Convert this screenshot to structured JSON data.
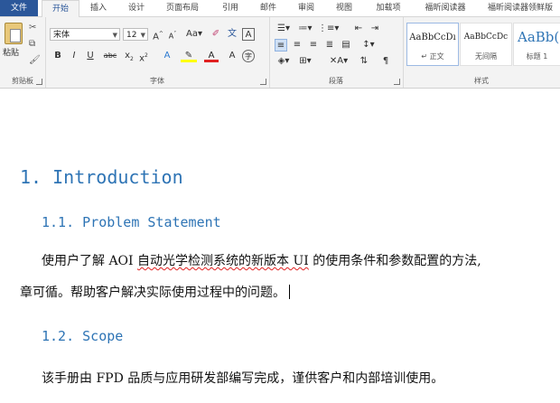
{
  "tabs": [
    "文件",
    "开始",
    "插入",
    "设计",
    "页面布局",
    "引用",
    "邮件",
    "审阅",
    "视图",
    "加载项",
    "福昕阅读器",
    "福昕阅读器领鲜版"
  ],
  "clipboard": {
    "paste_label": "粘贴",
    "group_label": "剪贴板"
  },
  "font": {
    "font_name": "宋体",
    "font_size": "12",
    "group_label": "字体"
  },
  "paragraph": {
    "group_label": "段落"
  },
  "styles": {
    "group_label": "样式",
    "items": [
      {
        "sample": "AaBbCcDı",
        "name": "↵ 正文"
      },
      {
        "sample": "AaBbCcDc",
        "name": "无间隔"
      },
      {
        "sample": "AaBb(",
        "name": "标题 1"
      }
    ]
  },
  "document": {
    "h1": "1.   Introduction",
    "h2_1": "1.1.    Problem Statement",
    "para1_pre": "使用户了解 AOI ",
    "para1_err": "自动光学检测系统的新版本 UI",
    "para1_post": " 的使用条件和参数配置的方法,",
    "para2": "章可循。帮助客户解决实际使用过程中的问题。",
    "h2_2": "1.2.    Scope",
    "para3": "该手册由 FPD 品质与应用研发部编写完成，谨供客户和内部培训使用。"
  },
  "colors": {
    "accent": "#2b579a",
    "heading": "#2e74b5",
    "spell_error": "#e02020"
  }
}
